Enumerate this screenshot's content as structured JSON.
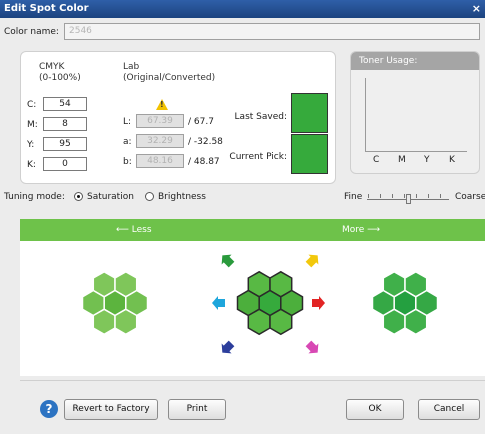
{
  "window": {
    "title": "Edit Spot Color",
    "close_glyph": "×"
  },
  "color_name": {
    "label": "Color name:",
    "value": "2546"
  },
  "cmyk": {
    "header": "CMYK\n(0-100%)",
    "rows": [
      {
        "label": "C:",
        "value": "54"
      },
      {
        "label": "M:",
        "value": "8"
      },
      {
        "label": "Y:",
        "value": "95"
      },
      {
        "label": "K:",
        "value": "0"
      }
    ]
  },
  "lab": {
    "header": "Lab\n(Original/Converted)",
    "warning_icon": "warning-icon",
    "rows": [
      {
        "label": "L:",
        "original": "67.39",
        "converted": "/ 67.7"
      },
      {
        "label": "a:",
        "original": "32.29",
        "converted": "/ -32.58"
      },
      {
        "label": "b:",
        "original": "48.16",
        "converted": "/ 48.87"
      }
    ]
  },
  "swatches": {
    "last_saved_label": "Last Saved:",
    "current_pick_label": "Current Pick:",
    "color": "#36aa3c"
  },
  "toner": {
    "title": "Toner Usage:",
    "labels": [
      "C",
      "M",
      "Y",
      "K"
    ]
  },
  "tuning": {
    "label": "Tuning mode:",
    "saturation": "Saturation",
    "brightness": "Brightness",
    "selected": "Saturation"
  },
  "granularity": {
    "fine": "Fine",
    "coarse": "Coarse"
  },
  "direction": {
    "less": "Less",
    "more": "More",
    "color": "#6ec24a"
  },
  "buttons": {
    "help": "?",
    "revert": "Revert to Factory",
    "print": "Print",
    "ok": "OK",
    "cancel": "Cancel"
  },
  "arrow_colors": [
    "#2a9a3c",
    "#f2c80c",
    "#e22424",
    "#d848b4",
    "#2c3e9c",
    "#1ea6dc"
  ]
}
